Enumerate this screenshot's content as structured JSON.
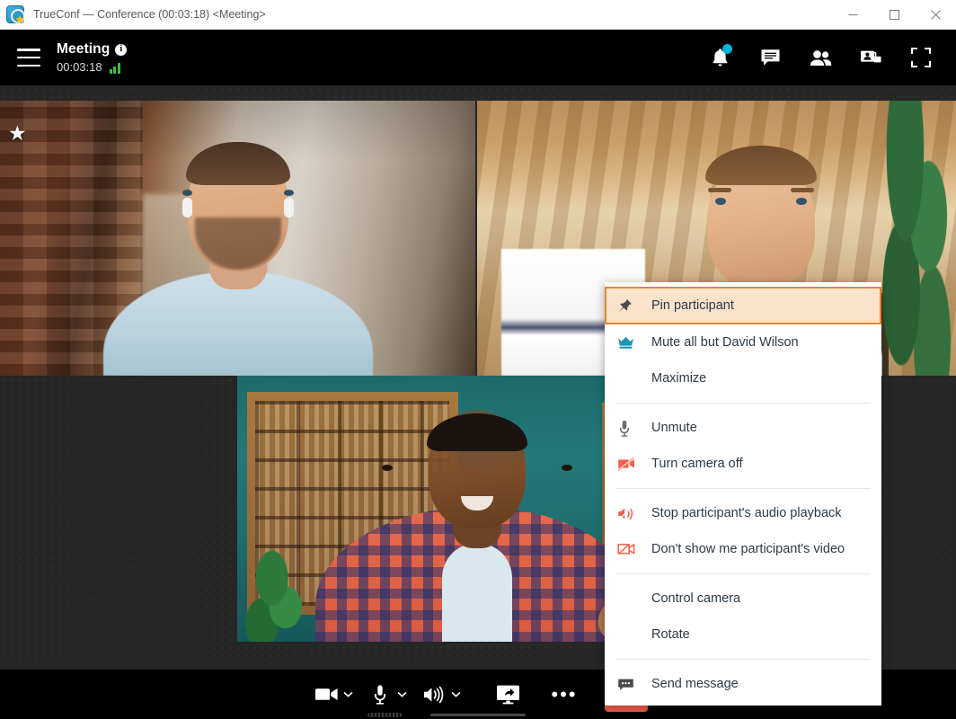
{
  "window": {
    "title": "TrueConf — Conference (00:03:18) <Meeting>",
    "logo_icon": "trueconf-logo-icon",
    "controls": {
      "minimize": "minimize-icon",
      "maximize": "maximize-icon",
      "close": "close-icon"
    }
  },
  "header": {
    "menu_icon": "hamburger-menu-icon",
    "conference_name": "Meeting",
    "info_icon": "info-icon",
    "timer": "00:03:18",
    "signal_icon": "signal-strength-icon",
    "actions": [
      {
        "name": "notifications-button",
        "icon": "bell-icon",
        "badge": true
      },
      {
        "name": "chat-button",
        "icon": "chat-bubble-icon",
        "badge": false
      },
      {
        "name": "participants-button",
        "icon": "participants-icon",
        "badge": false
      },
      {
        "name": "layout-button",
        "icon": "video-layout-icon",
        "badge": false
      },
      {
        "name": "fullscreen-button",
        "icon": "fullscreen-icon",
        "badge": false
      }
    ],
    "accent_badge_color": "#00b4d8"
  },
  "video_grid": {
    "speaker_star_icon": "star-icon",
    "tiles": [
      {
        "name": "video-tile-1",
        "pinned": true
      },
      {
        "name": "video-tile-2",
        "pinned": false
      },
      {
        "name": "video-tile-3",
        "pinned": false
      }
    ]
  },
  "context_menu": {
    "highlight_border_color": "#e8862a",
    "highlight_fill_color": "#fbe3cb",
    "groups": [
      {
        "items": [
          {
            "label": "Pin participant",
            "icon": "pin-icon",
            "highlighted": true
          },
          {
            "label": "Mute all but David Wilson",
            "icon": "crown-icon",
            "highlighted": false
          },
          {
            "label": "Maximize",
            "icon": "",
            "highlighted": false
          }
        ]
      },
      {
        "items": [
          {
            "label": "Unmute",
            "icon": "microphone-icon",
            "highlighted": false
          },
          {
            "label": "Turn camera off",
            "icon": "camera-off-icon",
            "highlighted": false
          }
        ]
      },
      {
        "items": [
          {
            "label": "Stop participant's audio playback",
            "icon": "speaker-mute-icon",
            "highlighted": false
          },
          {
            "label": "Don't show me participant's video",
            "icon": "video-off-icon",
            "highlighted": false
          }
        ]
      },
      {
        "items": [
          {
            "label": "Control camera",
            "icon": "",
            "highlighted": false
          },
          {
            "label": "Rotate",
            "icon": "",
            "highlighted": false
          }
        ]
      },
      {
        "items": [
          {
            "label": "Send message",
            "icon": "message-icon",
            "highlighted": false
          }
        ]
      }
    ]
  },
  "toolbar": {
    "camera_icon": "camera-icon",
    "camera_caret_icon": "chevron-down-icon",
    "mic_icon": "microphone-icon",
    "mic_caret_icon": "chevron-down-icon",
    "mic_level_meter": "mic-level-meter",
    "speaker_icon": "speaker-icon",
    "speaker_caret_icon": "chevron-down-icon",
    "share_icon": "screen-share-icon",
    "more_icon": "more-options-icon",
    "hangup_icon": "hangup-icon",
    "hangup_color": "#f25c46"
  }
}
